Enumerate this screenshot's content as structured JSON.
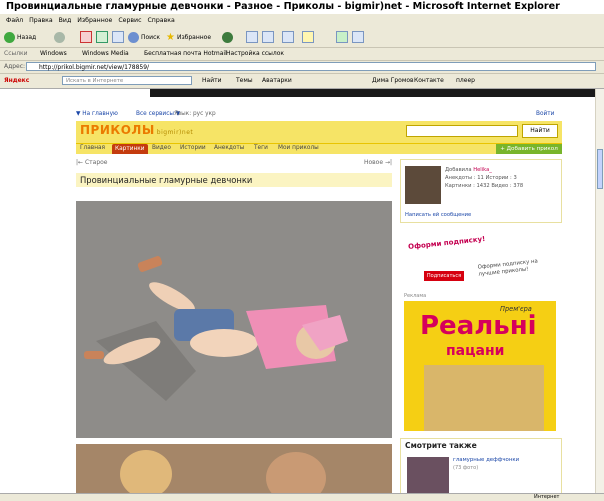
{
  "window": {
    "title": "Провинциальные гламурные девчонки - Разное - Приколы - bigmir)net - Microsoft Internet Explorer"
  },
  "menu": [
    "Файл",
    "Правка",
    "Вид",
    "Избранное",
    "Сервис",
    "Справка"
  ],
  "toolbar": {
    "back": "Назад",
    "search": "Поиск",
    "favorites": "Избранное"
  },
  "links": {
    "label": "Ссылки",
    "items": [
      "Windows",
      "Windows Media",
      "Бесплатная почта Hotmail",
      "Настройка ссылок"
    ]
  },
  "address": {
    "label": "Адрес:",
    "url": "http://prikol.bigmir.net/view/178859/"
  },
  "yandex": {
    "brand": "Яндекс",
    "placeholder": "Искать в Интернете",
    "find": "Найти",
    "themes": "Темы",
    "avatars": "Аватарки",
    "user": "Дима Громов",
    "contacts": "Контакте",
    "player": "плеер"
  },
  "status": {
    "zone": "Интернет"
  },
  "site": {
    "nav": {
      "home": "▼ На главную",
      "services": "Все сервисы ▼",
      "lang": "Язык: рус укр",
      "login": "Войти"
    },
    "logo": "ПРИКОЛЫ",
    "logo_sub": "bigmir)net",
    "search_button": "Найти",
    "tabs": [
      "Главная",
      "Картинки",
      "Видео",
      "Истории",
      "Анекдоты",
      "Теги",
      "Мои приколы"
    ],
    "add_button": "+ Добавить прикол",
    "older": "|← Старое",
    "newer": "Новое →|",
    "page_title": "Провинциальные гламурные девчонки"
  },
  "user": {
    "added_label": "Добавила",
    "name": "Helika_",
    "stats1": "Анекдоты : 11   Истории : 3",
    "stats2": "Картинки : 1432   Видео : 378",
    "send": "Написать ей сообщение"
  },
  "promo": {
    "headline": "Оформи подписку!",
    "button": "Подписаться",
    "text": "Оформи подписку на лучшие приколы!"
  },
  "ad": {
    "label": "Реклама",
    "line1": "Реальні",
    "line2": "пацани",
    "premiere": "Прем'єра"
  },
  "related": {
    "heading": "Смотрите также",
    "item_title": "гламурные деффчонки",
    "item_count": "(73 фото)"
  }
}
